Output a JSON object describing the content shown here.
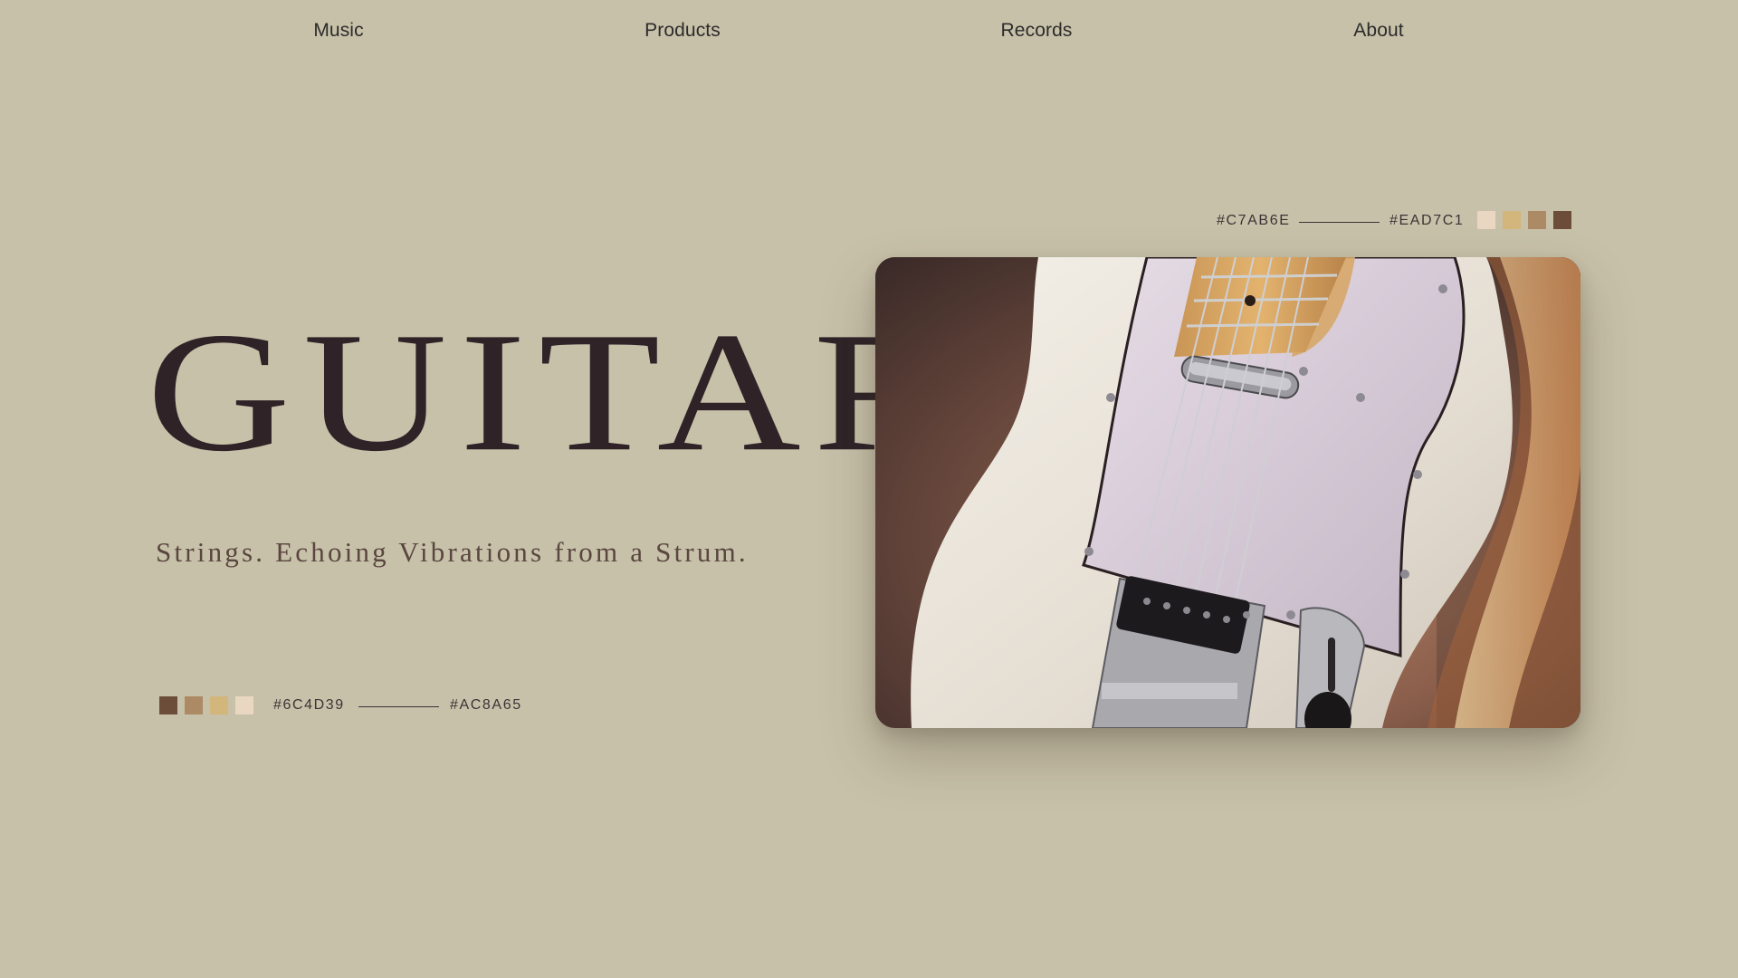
{
  "nav": {
    "items": [
      {
        "label": "Music"
      },
      {
        "label": "Products"
      },
      {
        "label": "Records"
      },
      {
        "label": "About"
      }
    ]
  },
  "hero": {
    "title": "GUITAR",
    "subtitle": "Strings. Echoing Vibrations from a Strum."
  },
  "palette_left": {
    "swatches": [
      "#6C4D39",
      "#AC8A65",
      "#D2B67B",
      "#EAD7C1"
    ],
    "start_hex": "#6C4D39",
    "end_hex": "#AC8A65"
  },
  "palette_right": {
    "start_hex": "#C7AB6E",
    "end_hex": "#EAD7C1",
    "swatches": [
      "#EAD7C1",
      "#D2B67B",
      "#AC8A65",
      "#6C4D39"
    ]
  },
  "photo": {
    "subject": "guitar-photo"
  },
  "colors": {
    "background": "#C8C1A9",
    "title": "#2F2328",
    "subtitle": "#5A4640"
  }
}
